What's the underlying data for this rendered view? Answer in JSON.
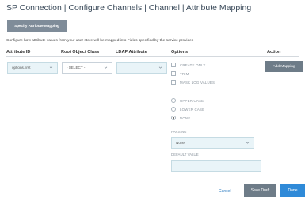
{
  "breadcrumb": {
    "title": "SP Connection | Configure Channels | Channel | Attribute Mapping"
  },
  "tab": {
    "label": "Specify Attribute Mapping"
  },
  "description": "Configure how attribute values from your user store will be mapped into Fields specified by the service provider.",
  "table": {
    "headers": {
      "attribute_id": "Attribute ID",
      "root_object_class": "Root Object Class",
      "ldap_attribute": "LDAP Attribute",
      "options": "Options",
      "action": "Action"
    }
  },
  "row": {
    "attribute_id_value": "options.first",
    "root_object_class_value": "- SELECT -",
    "ldap_attribute_value": ""
  },
  "options": {
    "checkboxes": [
      {
        "label": "CREATE ONLY",
        "checked": false
      },
      {
        "label": "TRIM",
        "checked": false
      },
      {
        "label": "MASK LOG VALUES",
        "checked": false
      }
    ],
    "case_radios": [
      {
        "label": "UPPER CASE",
        "selected": false
      },
      {
        "label": "LOWER CASE",
        "selected": false
      },
      {
        "label": "NONE",
        "selected": true
      }
    ],
    "parsing_label": "PARSING",
    "parsing_value": "None",
    "default_value_label": "DEFAULT VALUE",
    "default_value": ""
  },
  "actions": {
    "add_mapping_label": "Add Mapping"
  },
  "footer": {
    "cancel_label": "Cancel",
    "save_draft_label": "Save Draft",
    "done_label": "Done"
  },
  "colors": {
    "primary_button": "#2f8ad8",
    "secondary_button": "#6e7c88",
    "link": "#2f7ec2",
    "filled_field": "#e9f4f8"
  },
  "icons": {
    "dropdown": "chevron-down-icon"
  }
}
